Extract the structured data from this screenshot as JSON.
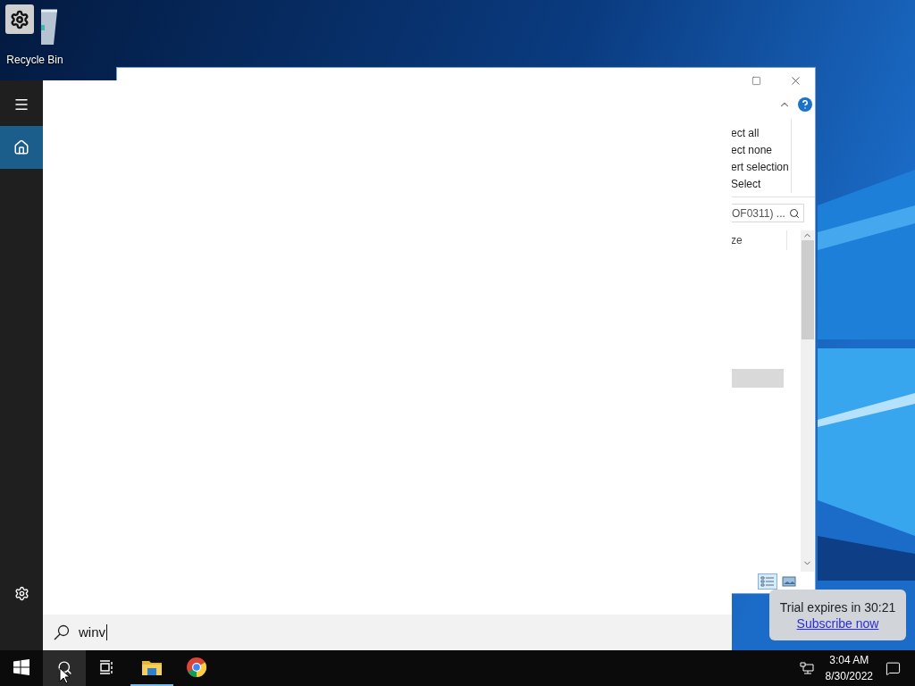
{
  "desktop": {
    "icons": [
      {
        "label": "Recycle Bin"
      }
    ]
  },
  "explorer": {
    "ribbon_items": [
      "ect all",
      "ect none",
      "ert selection",
      "Select"
    ],
    "search": {
      "value": "OF0311) ..."
    },
    "column_header": "ze",
    "views": [
      {
        "selected": true
      },
      {
        "selected": false
      }
    ]
  },
  "start_menu": {
    "rail": [
      {
        "kind": "menu",
        "selected": false
      },
      {
        "kind": "home",
        "selected": true
      },
      {
        "kind": "settings",
        "selected": false
      }
    ],
    "search": {
      "value": "winv"
    }
  },
  "taskbar": {
    "apps": [
      {
        "kind": "start",
        "selected": false,
        "running": false
      },
      {
        "kind": "search",
        "selected": true,
        "running": false
      },
      {
        "kind": "taskview",
        "selected": false,
        "running": false
      },
      {
        "kind": "explorer",
        "selected": false,
        "running": true
      },
      {
        "kind": "chrome",
        "selected": false,
        "running": false
      }
    ],
    "time": "3:04 AM",
    "date": "8/30/2022"
  },
  "toast": {
    "message": "Trial expires in 30:21",
    "link": "Subscribe now"
  }
}
